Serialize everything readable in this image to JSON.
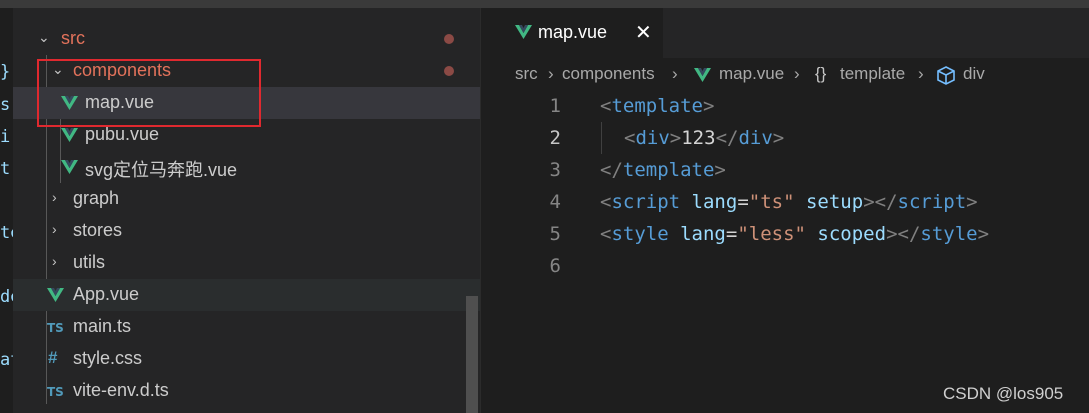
{
  "left_fragments": [
    "}",
    "s",
    "ir",
    "t:",
    "te",
    "de",
    "at"
  ],
  "explorer": {
    "rows": [
      {
        "label": "src",
        "kind": "folder-open",
        "modified": true
      },
      {
        "label": "components",
        "kind": "folder-open",
        "modified": true
      },
      {
        "label": "map.vue",
        "kind": "vue",
        "selected": true
      },
      {
        "label": "pubu.vue",
        "kind": "vue"
      },
      {
        "label": "svg定位马奔跑.vue",
        "kind": "vue"
      },
      {
        "label": "graph",
        "kind": "folder-closed"
      },
      {
        "label": "stores",
        "kind": "folder-closed"
      },
      {
        "label": "utils",
        "kind": "folder-closed"
      },
      {
        "label": "App.vue",
        "kind": "vue"
      },
      {
        "label": "main.ts",
        "kind": "ts",
        "icon_text": "TS"
      },
      {
        "label": "style.css",
        "kind": "css",
        "icon_text": "#"
      },
      {
        "label": "vite-env.d.ts",
        "kind": "ts",
        "icon_text": "TS"
      }
    ]
  },
  "editor": {
    "tab": {
      "label": "map.vue",
      "close": "✕"
    },
    "breadcrumb": {
      "seg1": "src",
      "seg2": "components",
      "seg3": "map.vue",
      "seg4_icon": "{}",
      "seg4": "template",
      "seg5": "div",
      "sep": "›"
    },
    "line_numbers": [
      "1",
      "2",
      "3",
      "4",
      "5",
      "6"
    ],
    "code": {
      "l1": {
        "open": "<",
        "tag": "template",
        "close": ">"
      },
      "l2": {
        "open": "<",
        "tag": "div",
        "close": ">",
        "text": "123",
        "end_open": "</",
        "end_tag": "div",
        "end_close": ">"
      },
      "l3": {
        "open": "</",
        "tag": "template",
        "close": ">"
      },
      "l4": {
        "open": "<",
        "tag": "script",
        "attr1": "lang",
        "eq": "=",
        "val": "\"ts\"",
        "attr2": "setup",
        "close": "></",
        "end_tag": "script",
        "end_close": ">"
      },
      "l5": {
        "open": "<",
        "tag": "style",
        "attr1": "lang",
        "eq": "=",
        "val": "\"less\"",
        "attr2": "scoped",
        "close": "></",
        "end_tag": "style",
        "end_close": ">"
      }
    }
  },
  "colors": {
    "modified": "#e2725b",
    "vue_green": "#41b883",
    "highlight_box": "#e0292f"
  },
  "watermark": "CSDN @los905"
}
